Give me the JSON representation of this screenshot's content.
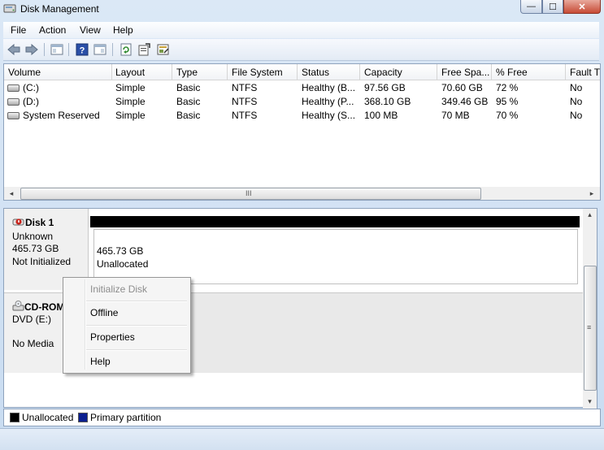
{
  "window": {
    "title": "Disk Management",
    "app_icon": "disk-management-icon",
    "caption_buttons": {
      "minimize": "—",
      "maximize": "☐",
      "close": "✕"
    }
  },
  "menu": {
    "file": "File",
    "action": "Action",
    "view": "View",
    "help": "Help"
  },
  "toolbar": {
    "icons": [
      "back-arrow-icon",
      "forward-arrow-icon",
      "show-hide-console-tree-icon",
      "help-icon",
      "show-action-pane-icon",
      "refresh-icon",
      "properties-icon",
      "export-icon"
    ]
  },
  "volumes": {
    "columns": [
      "Volume",
      "Layout",
      "Type",
      "File System",
      "Status",
      "Capacity",
      "Free Spa...",
      "% Free",
      "Fault T"
    ],
    "rows": [
      {
        "volume": "(C:)",
        "layout": "Simple",
        "type": "Basic",
        "fs": "NTFS",
        "status": "Healthy (B...",
        "capacity": "97.56 GB",
        "free": "70.60 GB",
        "pct": "72 %",
        "fault": "No"
      },
      {
        "volume": "(D:)",
        "layout": "Simple",
        "type": "Basic",
        "fs": "NTFS",
        "status": "Healthy (P...",
        "capacity": "368.10 GB",
        "free": "349.46 GB",
        "pct": "95 %",
        "fault": "No"
      },
      {
        "volume": "System Reserved",
        "layout": "Simple",
        "type": "Basic",
        "fs": "NTFS",
        "status": "Healthy (S...",
        "capacity": "100 MB",
        "free": "70 MB",
        "pct": "70 %",
        "fault": "No"
      }
    ]
  },
  "hscroll": {
    "grip": "III",
    "left": "◂",
    "right": "▸"
  },
  "vscroll": {
    "grip": "≡",
    "up": "▴",
    "down": "▾"
  },
  "disk1": {
    "name": "Disk 1",
    "kind": "Unknown",
    "size": "465.73 GB",
    "state": "Not Initialized",
    "partition_size": "465.73 GB",
    "partition_label": "Unallocated"
  },
  "cdrom": {
    "name": "CD-ROM",
    "drive": "DVD (E:)",
    "media": "No Media"
  },
  "legend": {
    "unallocated": "Unallocated",
    "unallocated_color": "#000000",
    "primary": "Primary partition",
    "primary_color": "#0b1f8f"
  },
  "context_menu": {
    "initialize": "Initialize Disk",
    "offline": "Offline",
    "properties": "Properties",
    "help": "Help"
  }
}
